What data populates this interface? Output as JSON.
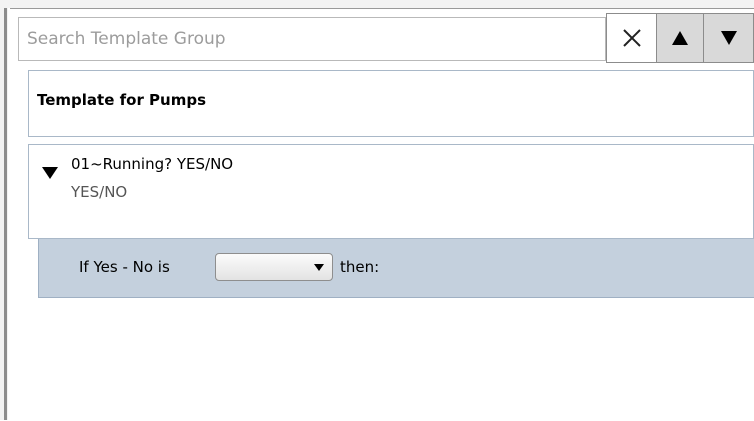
{
  "search": {
    "placeholder": "Search Template Group",
    "value": ""
  },
  "toolbar": {
    "clear_icon": "close-icon",
    "up_icon": "arrow-up-icon",
    "down_icon": "arrow-down-icon"
  },
  "template": {
    "title": "Template for Pumps"
  },
  "question": {
    "title": "01~Running? YES/NO",
    "subtitle": "YES/NO",
    "expander_icon": "triangle-down-icon"
  },
  "condition": {
    "label": "If Yes - No is",
    "select_value": "",
    "suffix": "then:"
  },
  "colors": {
    "condition_background": "#c4d0dd",
    "card_border": "#a9b8c8",
    "nav_button_background": "#d9d9d9"
  }
}
